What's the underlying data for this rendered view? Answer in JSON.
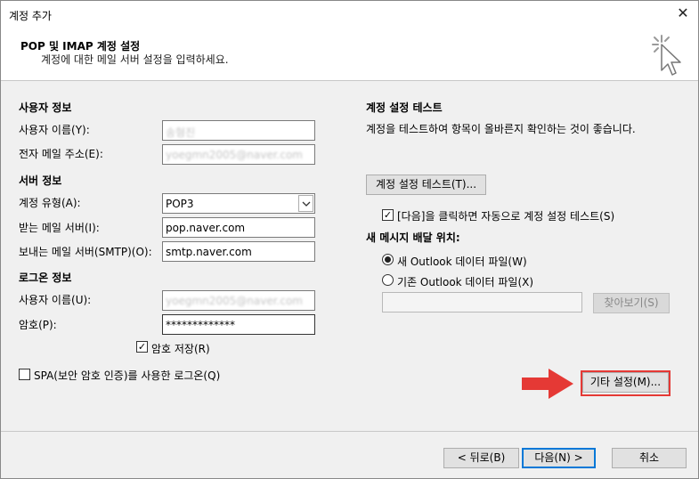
{
  "window": {
    "title": "계정 추가",
    "close_glyph": "✕"
  },
  "header": {
    "title": "POP 및 IMAP 계정 설정",
    "subtitle": "계정에 대한 메일 서버 설정을 입력하세요."
  },
  "user_info": {
    "section_label": "사용자 정보",
    "name_label": "사용자 이름(Y):",
    "name_value": "송형진",
    "email_label": "전자 메일 주소(E):",
    "email_value": "yoegmn2005@naver.com"
  },
  "server_info": {
    "section_label": "서버 정보",
    "account_type_label": "계정 유형(A):",
    "account_type_value": "POP3",
    "incoming_label": "받는 메일 서버(I):",
    "incoming_value": "pop.naver.com",
    "outgoing_label": "보내는 메일 서버(SMTP)(O):",
    "outgoing_value": "smtp.naver.com"
  },
  "login_info": {
    "section_label": "로그온 정보",
    "username_label": "사용자 이름(U):",
    "username_value": "yoegmn2005@naver.com",
    "password_label": "암호(P):",
    "password_value": "*************",
    "save_password_label": "암호 저장(R)",
    "save_password_checked": true,
    "spa_label": "SPA(보안 암호 인증)를 사용한 로그온(Q)",
    "spa_checked": false
  },
  "test_section": {
    "section_label": "계정 설정 테스트",
    "description": "계정을 테스트하여 항목이 올바른지 확인하는 것이 좋습니다.",
    "test_button": "계정 설정 테스트(T)...",
    "auto_test_label": "[다음]을 클릭하면 자동으로 계정 설정 테스트(S)",
    "auto_test_checked": true
  },
  "delivery": {
    "section_label": "새 메시지 배달 위치:",
    "new_file_label": "새 Outlook 데이터 파일(W)",
    "existing_file_label": "기존 Outlook 데이터 파일(X)",
    "selected": "new",
    "path_value": "",
    "browse_button": "찾아보기(S)"
  },
  "more_settings_button": "기타 설정(M)...",
  "footer": {
    "back_button": "< 뒤로(B)",
    "next_button": "다음(N) >",
    "cancel_button": "취소"
  },
  "colors": {
    "highlight": "#e53935",
    "primary_border": "#0078d7"
  },
  "icons": {
    "header_icon": "cursor-click-icon",
    "select_arrow": "chevron-down-icon",
    "annotation_arrow": "red-arrow-icon"
  }
}
